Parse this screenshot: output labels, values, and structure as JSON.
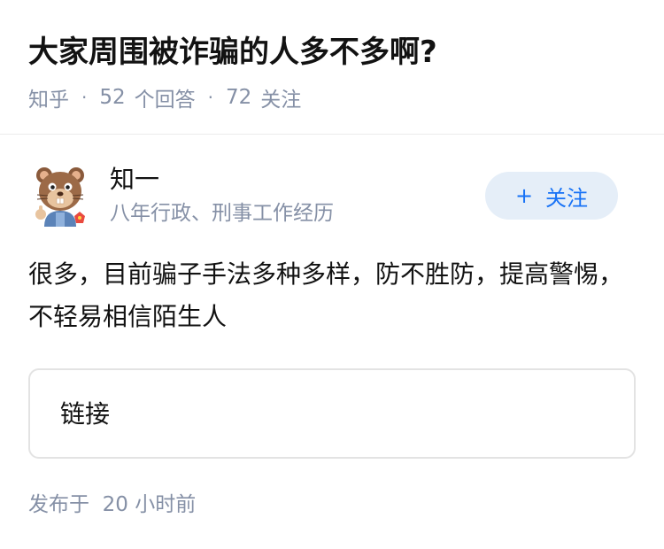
{
  "question": {
    "title": "大家周围被诈骗的人多不多啊?",
    "source": "知乎",
    "answer_count": "52",
    "answer_count_label": "个回答",
    "follow_count": "72",
    "follow_count_label": "关注"
  },
  "author": {
    "name": "知一",
    "bio": "八年行政、刑事工作经历",
    "avatar_icon": "cartoon-hamster-avatar",
    "follow_button_label": "关注",
    "follow_button_icon": "plus-icon",
    "accent_color": "#1772f6"
  },
  "answer": {
    "content": "很多，目前骗子手法多种多样，防不胜防，提高警惕，不轻易相信陌生人",
    "link_card_label": "链接",
    "publish_time": "发布于  20 小时前"
  }
}
